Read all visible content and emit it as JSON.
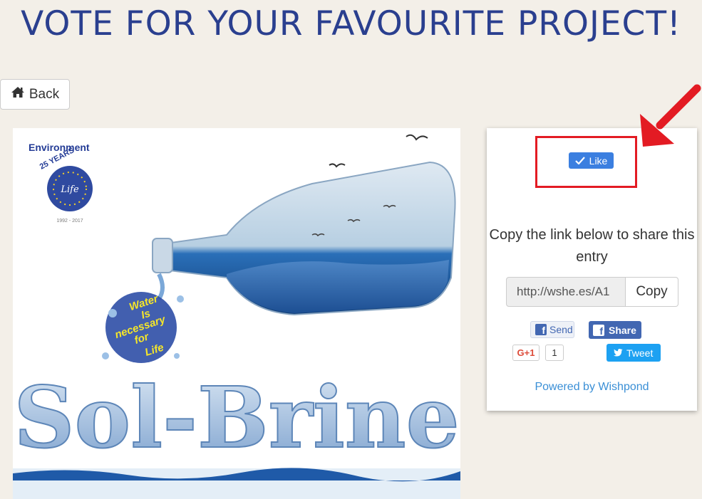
{
  "header": {
    "title": "VOTE FOR YOUR FAVOURITE PROJECT!"
  },
  "back_button": {
    "label": "Back",
    "icon": "home-icon"
  },
  "entry_image": {
    "logo_title": "Environment",
    "logo_years": "25 YEARS",
    "logo_life": "Life",
    "logo_dates": "1992 - 2017",
    "slogan_lines": [
      "Water",
      "Is",
      "necessary",
      "for",
      "Life"
    ],
    "project_name": "Sol-Brine"
  },
  "share_card": {
    "like_label": "Like",
    "copy_text": "Copy the link below to share this entry",
    "link_value": "http://wshe.es/A1",
    "copy_label": "Copy",
    "fb_send_label": "Send",
    "fb_share_label": "Share",
    "gplus_label": "G+1",
    "gplus_count": "1",
    "tweet_label": "Tweet",
    "powered_by": "Powered by Wishpond"
  },
  "colors": {
    "title": "#2a3f8f",
    "like_button": "#3b7fe0",
    "highlight": "#e31b23",
    "facebook": "#4267b2",
    "twitter": "#1da1f2",
    "link": "#3a8fd6"
  }
}
